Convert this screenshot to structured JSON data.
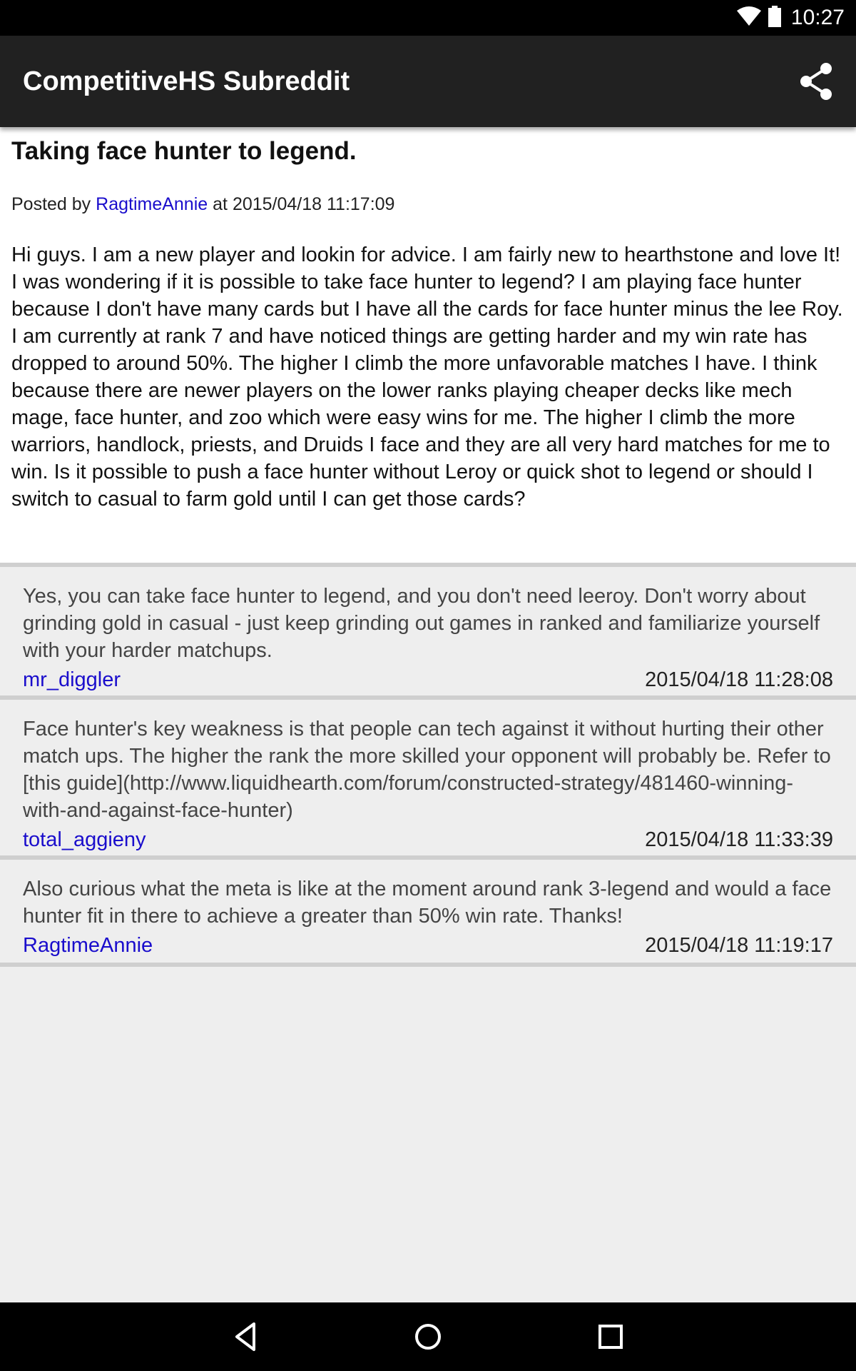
{
  "status_bar": {
    "time": "10:27",
    "icons": [
      "wifi-icon",
      "battery-icon"
    ]
  },
  "app_bar": {
    "title": "CompetitiveHS Subreddit",
    "action_icon": "share-icon"
  },
  "post": {
    "title": "Taking face hunter to legend.",
    "posted_by_prefix": "Posted by",
    "author": "RagtimeAnnie",
    "at_word": "at",
    "timestamp": "2015/04/18 11:17:09",
    "body": "Hi guys. I am a new player and lookin for advice. I am fairly new to hearthstone and love It! I was wondering if it is possible to take face hunter to legend? I am playing face hunter because I don't have many cards but I have all the cards for face hunter minus the lee Roy. I am currently at rank 7 and have noticed things are getting harder and my win rate has dropped to around 50%. The higher I climb the more unfavorable matches I have. I think because there are newer players on the lower ranks playing cheaper decks like mech mage, face hunter, and zoo which were easy wins for me. The higher I climb the more warriors, handlock, priests, and Druids I face and they are all very hard matches for me to win. Is it possible to push a face hunter without Leroy or quick shot to legend or should I switch to casual to farm gold until I can get those cards?"
  },
  "comments": [
    {
      "text": "Yes, you can take face hunter to legend, and you don't need leeroy. Don't worry about grinding gold in casual - just keep grinding out games in ranked and familiarize yourself with your harder matchups.",
      "author": "mr_diggler",
      "timestamp": "2015/04/18 11:28:08"
    },
    {
      "text": "Face hunter's key weakness is that people can tech against it without hurting their other match ups. The higher the rank the more skilled your opponent will probably be. Refer to [this guide](http://www.liquidhearth.com/forum/constructed-strategy/481460-winning-with-and-against-face-hunter)",
      "author": "total_aggieny",
      "timestamp": "2015/04/18 11:33:39"
    },
    {
      "text": "Also curious what the meta is like at the moment around rank 3-legend and would a face hunter fit in there to achieve a greater than 50% win rate. Thanks!",
      "author": "RagtimeAnnie",
      "timestamp": "2015/04/18 11:19:17"
    }
  ],
  "nav_bar": {
    "buttons": [
      "back-icon",
      "home-icon",
      "recents-icon"
    ]
  },
  "colors": {
    "link": "#1a0dcc",
    "app_bar": "#212121",
    "background": "#eeeeee"
  }
}
